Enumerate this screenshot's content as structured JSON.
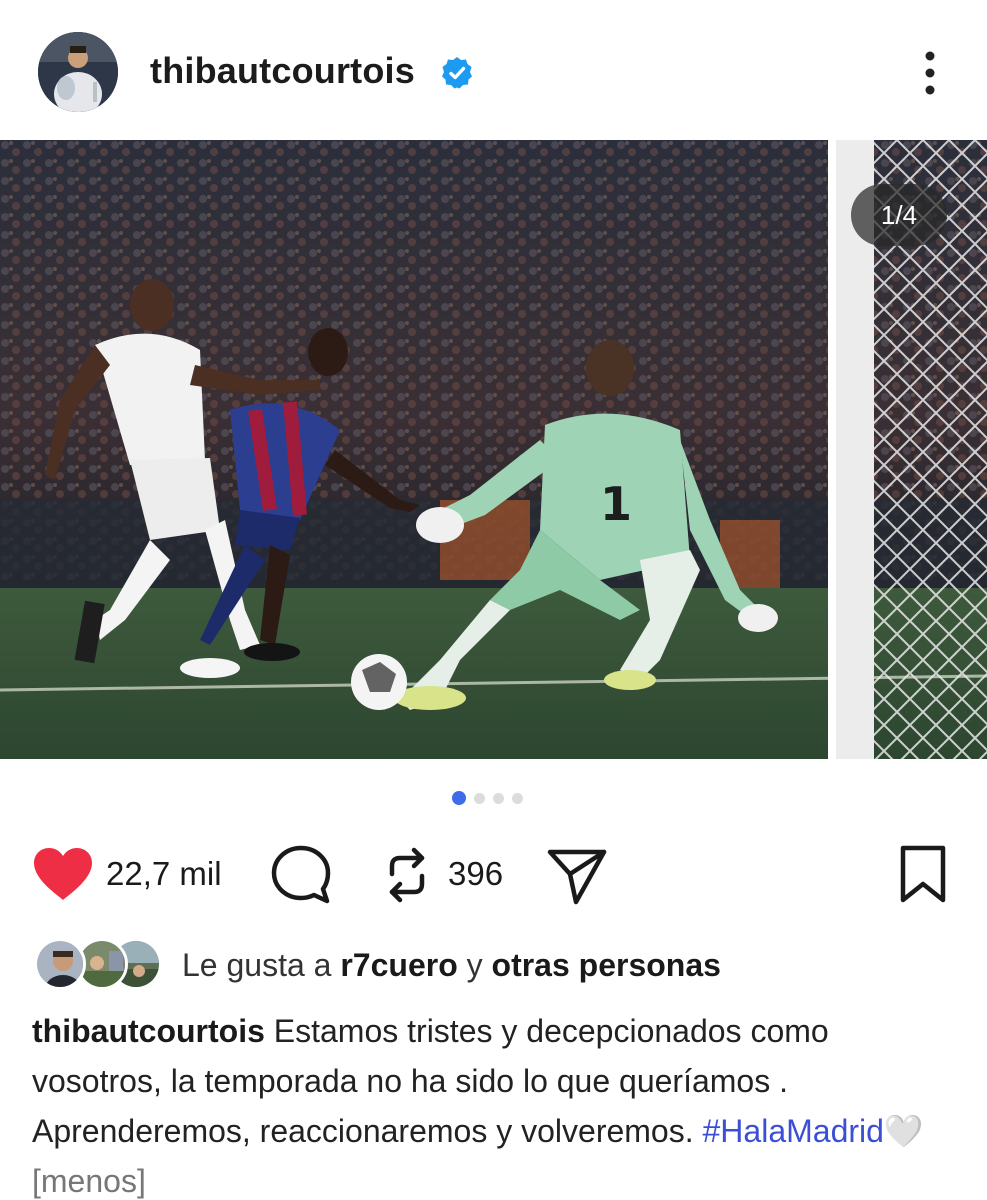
{
  "post": {
    "username": "thibautcourtois",
    "verified_icon": "verified-badge-icon",
    "more_icon": "more-vertical-icon",
    "image_counter": "1/4",
    "carousel": {
      "total": 4,
      "active_index": 0
    }
  },
  "actions": {
    "like_count": "22,7 mil",
    "repost_count": "396",
    "like_color": "#ee2e44"
  },
  "likes": {
    "prefix": "Le gusta a",
    "user": "r7cuero",
    "joiner": "y",
    "others": "otras personas"
  },
  "caption": {
    "user": "thibautcourtois",
    "text": "Estamos tristes y decepcionados como vosotros, la temporada no ha sido lo que queríamos . Aprenderemos, reaccionaremos y volveremos.",
    "hashtag": "#HalaMadrid",
    "emoji": "🤍",
    "toggle": "[menos]"
  },
  "colors": {
    "accent": "#3f6ce8",
    "verified": "#1d9bf0",
    "hashtag": "#3b4fd6"
  }
}
